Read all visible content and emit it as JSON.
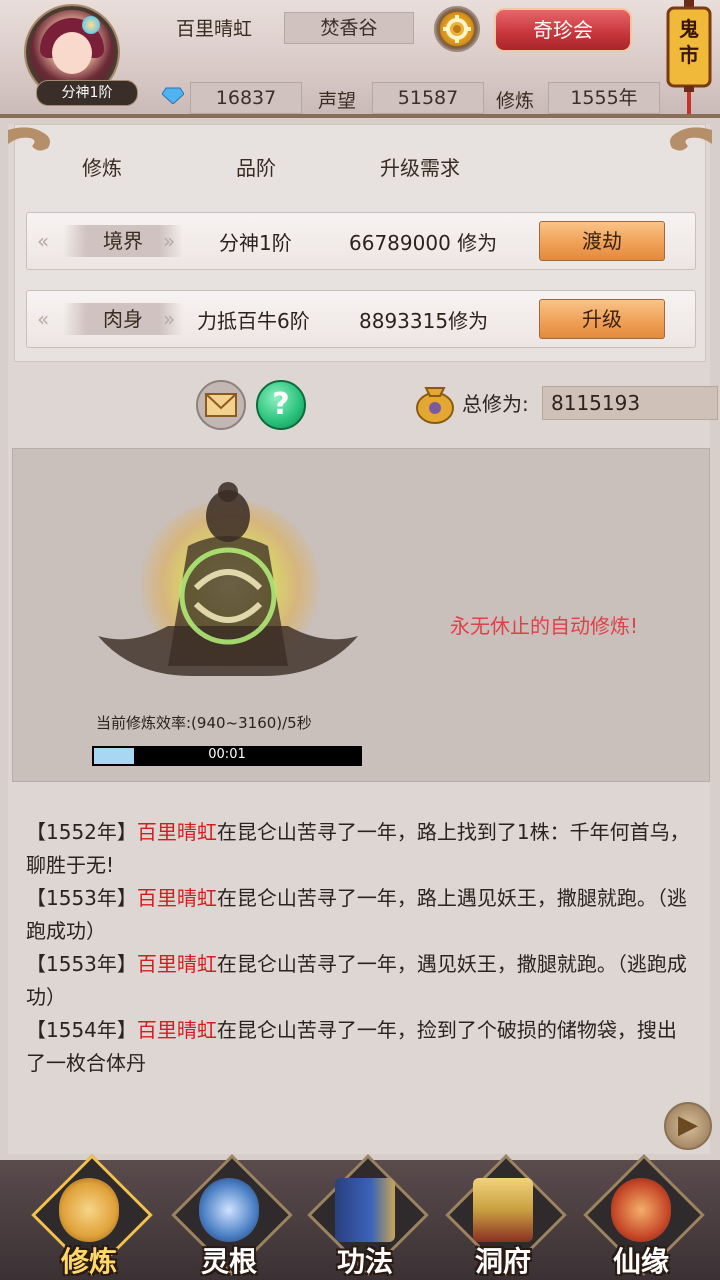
{
  "header": {
    "rank_badge": "分神1阶",
    "player_name": "百里晴虹",
    "sect": "焚香谷",
    "shop_button": "奇珍会",
    "ghost_market": "鬼市",
    "spirit_stones": "16837",
    "reputation_label": "声望",
    "reputation": "51587",
    "cultivation_label": "修炼",
    "cultivation_years": "1555年"
  },
  "subtabs": [
    "修炼",
    "品阶",
    "升级需求"
  ],
  "rows": [
    {
      "label": "境界",
      "grade": "分神1阶",
      "requirement": "66789000 修为",
      "button": "渡劫"
    },
    {
      "label": "肉身",
      "grade": "力抵百牛6阶",
      "requirement": "8893315修为",
      "button": "升级"
    }
  ],
  "total": {
    "label": "总修为:",
    "value": "8115193"
  },
  "training": {
    "rate_text": "当前修炼效率:(940~3160)/5秒",
    "progress": 0.15,
    "timer": "00:01",
    "auto_text": "永无休止的自动修炼!"
  },
  "log": [
    {
      "prefix": "【1552年】",
      "name": "百里晴虹",
      "text": "在昆仑山苦寻了一年，路上找到了1株：千年何首乌，聊胜于无!"
    },
    {
      "prefix": "【1553年】",
      "name": "百里晴虹",
      "text": "在昆仑山苦寻了一年，路上遇见妖王，撒腿就跑。（逃跑成功）"
    },
    {
      "prefix": "【1553年】",
      "name": "百里晴虹",
      "text": "在昆仑山苦寻了一年，遇见妖王，撒腿就跑。（逃跑成功）"
    },
    {
      "prefix": "【1554年】",
      "name": "百里晴虹",
      "text": "在昆仑山苦寻了一年，捡到了个破损的储物袋，搜出了一枚合体丹"
    }
  ],
  "nav": [
    {
      "label": "修炼",
      "icon": "cultivator-icon",
      "color": "#e0a23a"
    },
    {
      "label": "灵根",
      "icon": "spirit-root-icon",
      "color": "#4a7fc4"
    },
    {
      "label": "功法",
      "icon": "book-icon",
      "color": "#3a63b8"
    },
    {
      "label": "洞府",
      "icon": "pavilion-icon",
      "color": "#c9a040"
    },
    {
      "label": "仙缘",
      "icon": "gourd-icon",
      "color": "#c84a2a"
    }
  ],
  "colors": {
    "accent": "#c6353a",
    "button_orange": "#f0a158",
    "highlight_name": "#d21e1e"
  }
}
